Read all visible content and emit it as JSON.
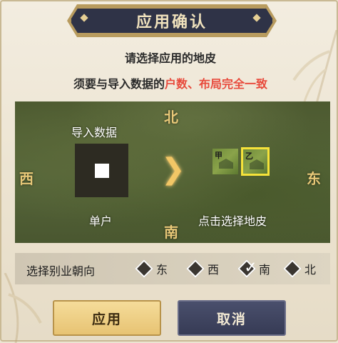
{
  "dialog": {
    "title": "应用确认",
    "subtitle": "请选择应用的地皮",
    "notice_prefix": "须要与导入数据的",
    "notice_highlight": "户数、布局完全一致"
  },
  "map": {
    "north": "北",
    "south": "南",
    "west": "西",
    "east": "东",
    "import_label": "导入数据",
    "layout_label": "单户",
    "select_label": "点击选择地皮",
    "skins": [
      {
        "tag": "甲",
        "selected": false
      },
      {
        "tag": "乙",
        "selected": true
      }
    ]
  },
  "orientation": {
    "label": "选择别业朝向",
    "options": [
      {
        "label": "东",
        "checked": false
      },
      {
        "label": "西",
        "checked": false
      },
      {
        "label": "南",
        "checked": true
      },
      {
        "label": "北",
        "checked": false
      }
    ]
  },
  "buttons": {
    "apply": "应用",
    "cancel": "取消"
  },
  "colors": {
    "title_bg": "#2f3347",
    "title_text": "#f0e2bd",
    "highlight": "#e84a3c",
    "direction_text": "#e8c878",
    "selected_border": "#f5e23a",
    "apply_button": "#e7c373",
    "cancel_button": "#363b55"
  }
}
